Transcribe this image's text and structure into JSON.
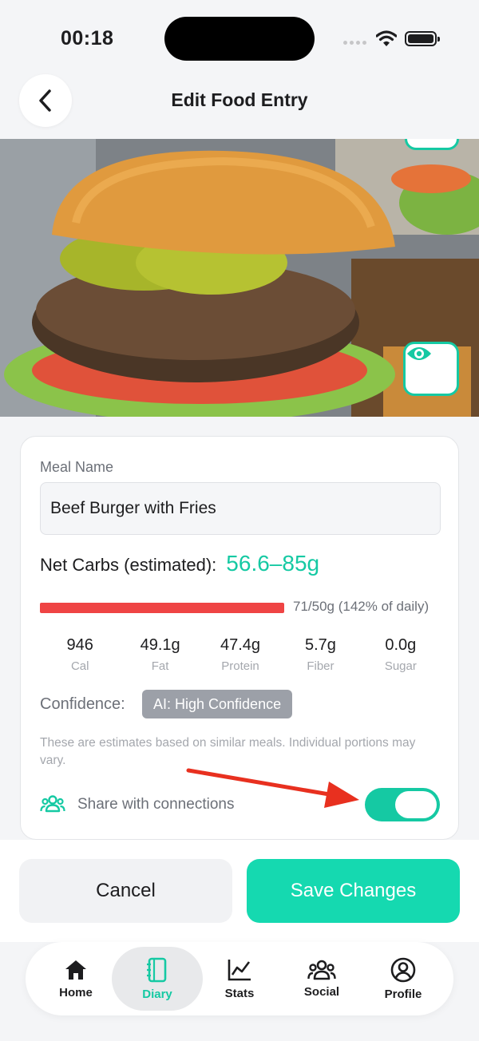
{
  "status_bar": {
    "time": "00:18"
  },
  "header": {
    "title": "Edit Food Entry",
    "back_icon": "chevron-left-icon"
  },
  "photo": {
    "view_icon": "eye-icon"
  },
  "form": {
    "meal_name_label": "Meal Name",
    "meal_name_value": "Beef Burger with Fries",
    "net_carbs_label": "Net Carbs (estimated):",
    "net_carbs_value": "56.6–85g",
    "carb_progress_text": "71/50g (142% of daily)",
    "carb_progress_fraction": 1.0,
    "macros": [
      {
        "value": "946",
        "label": "Cal"
      },
      {
        "value": "49.1g",
        "label": "Fat"
      },
      {
        "value": "47.4g",
        "label": "Protein"
      },
      {
        "value": "5.7g",
        "label": "Fiber"
      },
      {
        "value": "0.0g",
        "label": "Sugar"
      }
    ],
    "confidence_label": "Confidence:",
    "confidence_value": "AI: High Confidence",
    "disclaimer": "These are estimates based on similar meals. Individual portions may vary.",
    "share_label": "Share with connections",
    "share_enabled": true
  },
  "actions": {
    "cancel_label": "Cancel",
    "save_label": "Save Changes"
  },
  "tabs": [
    {
      "label": "Home",
      "icon": "home-icon",
      "active": false
    },
    {
      "label": "Diary",
      "icon": "diary-icon",
      "active": true
    },
    {
      "label": "Stats",
      "icon": "chart-icon",
      "active": false
    },
    {
      "label": "Social",
      "icon": "people-icon",
      "active": false
    },
    {
      "label": "Profile",
      "icon": "profile-icon",
      "active": false
    }
  ],
  "colors": {
    "accent": "#15c9a3",
    "warning": "#ef4444",
    "annotation_arrow": "#e8301f"
  }
}
